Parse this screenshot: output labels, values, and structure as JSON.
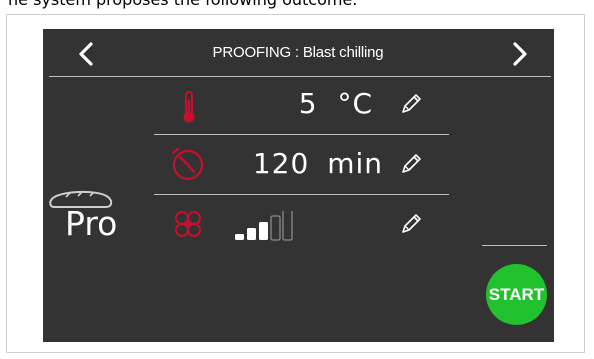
{
  "caption_partial": "he system proposes the following outcome.",
  "header": {
    "title": "PROOFING : Blast chilling",
    "prev_icon": "chevron-left-icon",
    "next_icon": "chevron-right-icon"
  },
  "program": {
    "icon": "bread-icon",
    "label": "Pro"
  },
  "params": {
    "temperature": {
      "icon": "thermometer-icon",
      "value": "5",
      "unit": "°C"
    },
    "time": {
      "icon": "timer-icon",
      "value": "120",
      "unit": "min"
    },
    "fan": {
      "icon": "fan-icon",
      "level": 3,
      "max_level": 5
    }
  },
  "start_button": {
    "label": "START"
  },
  "colors": {
    "screen_bg": "#333333",
    "accent_red": "#c8102e",
    "start_green": "#22c12e"
  }
}
